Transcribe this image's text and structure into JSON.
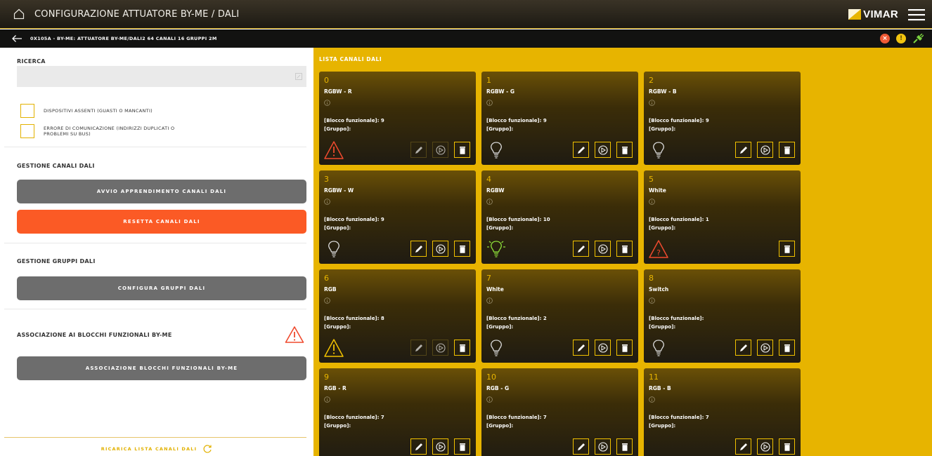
{
  "header": {
    "title": "CONFIGURAZIONE ATTUATORE BY-ME / DALI",
    "brand": "VIMAR"
  },
  "subheader": {
    "device_title": "0X105A - BY-ME: ATTUATORE BY-ME/DALI2 64 CANALI 16 GRUPPI 2M",
    "status_error_symbol": "×",
    "status_warning_symbol": "!"
  },
  "left": {
    "search_label": "RICERCA",
    "search_placeholder": "",
    "filters": [
      {
        "label": "DISPOSITIVI ASSENTI (GUASTI O MANCANTI)",
        "checked": false
      },
      {
        "label": "ERRORE DI COMUNICAZIONE (INDIRIZZI DUPLICATI O PROBLEMI SU BUS)",
        "checked": false
      }
    ],
    "channels_section": "GESTIONE CANALI DALI",
    "start_learning_button": "AVVIO APPRENDIMENTO CANALI DALI",
    "reset_button": "RESETTA CANALI DALI",
    "groups_section": "GESTIONE GRUPPI DALI",
    "configure_groups_button": "CONFIGURA GRUPPI DALI",
    "association_section": "ASSOCIAZIONE AI BLOCCHI FUNZIONALI BY-ME",
    "association_button": "ASSOCIAZIONE BLOCCHI FUNZIONALI BY-ME",
    "reload_label": "RICARICA LISTA CANALI DALI"
  },
  "right": {
    "list_title": "LISTA CANALI DALI",
    "channels": [
      {
        "number": "0",
        "name": "RGBW - R",
        "block": "[Blocco funzionale]: 9",
        "group": "[Gruppo]:",
        "state": "warning-red",
        "actions_enabled": false,
        "show_edit": true,
        "show_identify": true
      },
      {
        "number": "1",
        "name": "RGBW - G",
        "block": "[Blocco funzionale]: 9",
        "group": "[Gruppo]:",
        "state": "bulb-off",
        "actions_enabled": true,
        "show_edit": true,
        "show_identify": true
      },
      {
        "number": "2",
        "name": "RGBW - B",
        "block": "[Blocco funzionale]: 9",
        "group": "[Gruppo]:",
        "state": "bulb-off",
        "actions_enabled": true,
        "show_edit": true,
        "show_identify": true
      },
      {
        "number": "3",
        "name": "RGBW - W",
        "block": "[Blocco funzionale]: 9",
        "group": "[Gruppo]:",
        "state": "bulb-off",
        "actions_enabled": true,
        "show_edit": true,
        "show_identify": true
      },
      {
        "number": "4",
        "name": "RGBW",
        "block": "[Blocco funzionale]: 10",
        "group": "[Gruppo]:",
        "state": "bulb-on",
        "actions_enabled": true,
        "show_edit": true,
        "show_identify": true
      },
      {
        "number": "5",
        "name": "White",
        "block": "[Blocco funzionale]: 1",
        "group": "[Gruppo]:",
        "state": "unknown-red",
        "actions_enabled": true,
        "show_edit": false,
        "show_identify": false
      },
      {
        "number": "6",
        "name": "RGB",
        "block": "[Blocco funzionale]: 8",
        "group": "[Gruppo]:",
        "state": "warning-yellow",
        "actions_enabled": false,
        "show_edit": true,
        "show_identify": true
      },
      {
        "number": "7",
        "name": "White",
        "block": "[Blocco funzionale]: 2",
        "group": "[Gruppo]:",
        "state": "bulb-off",
        "actions_enabled": true,
        "show_edit": true,
        "show_identify": true
      },
      {
        "number": "8",
        "name": "Switch",
        "block": "[Blocco funzionale]:",
        "group": "[Gruppo]:",
        "state": "bulb-off",
        "actions_enabled": true,
        "show_edit": true,
        "show_identify": true
      },
      {
        "number": "9",
        "name": "RGB - R",
        "block": "[Blocco funzionale]: 7",
        "group": "[Gruppo]:",
        "state": "none",
        "actions_enabled": true,
        "show_edit": true,
        "show_identify": true
      },
      {
        "number": "10",
        "name": "RGB - G",
        "block": "[Blocco funzionale]: 7",
        "group": "[Gruppo]:",
        "state": "none",
        "actions_enabled": true,
        "show_edit": true,
        "show_identify": true
      },
      {
        "number": "11",
        "name": "RGB - B",
        "block": "[Blocco funzionale]: 7",
        "group": "[Gruppo]:",
        "state": "none",
        "actions_enabled": true,
        "show_edit": true,
        "show_identify": true
      }
    ]
  },
  "colors": {
    "accent": "#e7b400",
    "danger": "#fb5a25",
    "warning_red": "#ef4a2e",
    "bulb_on": "#8ee03a",
    "card_dark": "#1f1b12"
  }
}
